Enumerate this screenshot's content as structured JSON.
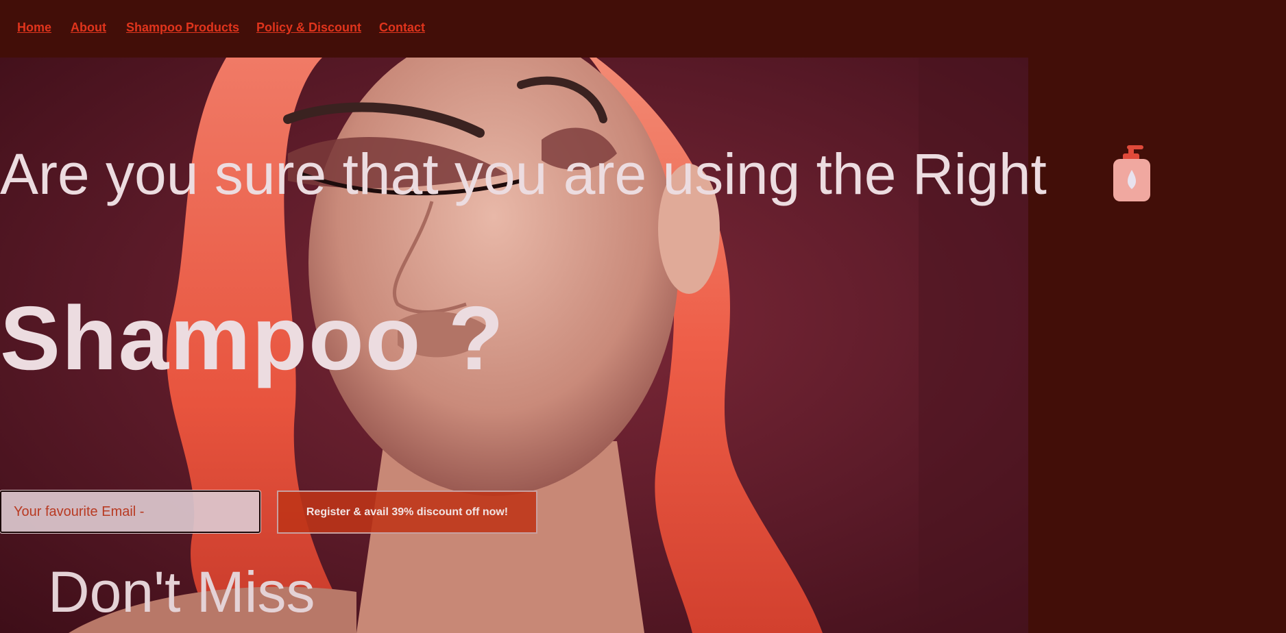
{
  "nav": {
    "items": [
      {
        "label": "Home"
      },
      {
        "label": "About"
      },
      {
        "label": "Shampoo Products"
      },
      {
        "label": "Policy & Discount"
      },
      {
        "label": "Contact"
      }
    ]
  },
  "hero": {
    "headline": "Are you sure that you are using the Right",
    "headline_icon": "shampoo-bottle-icon",
    "headline_big": "Shampoo ?",
    "email_placeholder": "Your favourite Email -",
    "cta_label": "Register & avail 39% discount off now!",
    "subheading": "Don't Miss"
  },
  "colors": {
    "background": "#420e08",
    "nav_link": "#e0341c",
    "headline_text": "#ecdce0",
    "cta_background": "#be3418",
    "email_text": "#b83a22"
  }
}
